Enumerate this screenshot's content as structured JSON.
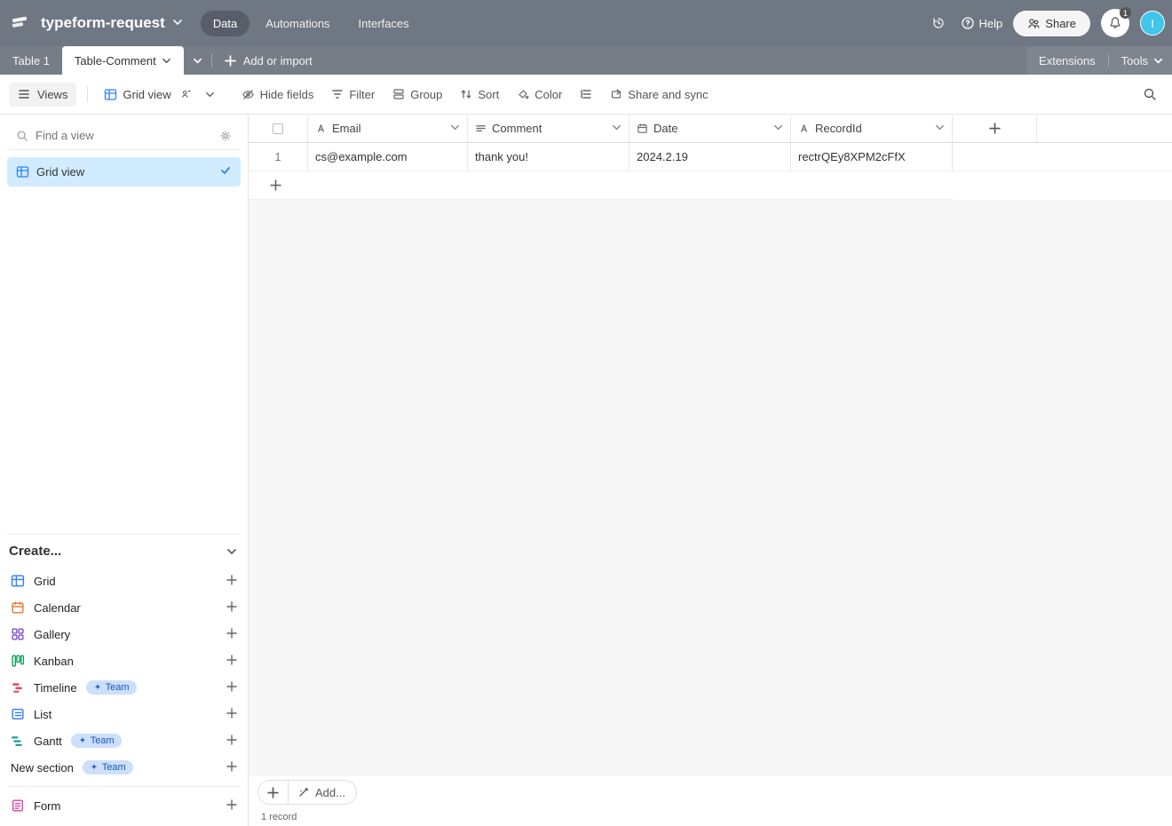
{
  "base_name": "typeform-request",
  "nav": {
    "data": "Data",
    "automations": "Automations",
    "interfaces": "Interfaces"
  },
  "topbar": {
    "help": "Help",
    "share": "Share",
    "notif_count": "1",
    "avatar_initial": "I"
  },
  "tabs": {
    "table1": "Table 1",
    "table_comment": "Table-Comment",
    "add_import": "Add or import",
    "extensions": "Extensions",
    "tools": "Tools"
  },
  "toolbar": {
    "views": "Views",
    "grid_view": "Grid view",
    "hide_fields": "Hide fields",
    "filter": "Filter",
    "group": "Group",
    "sort": "Sort",
    "color": "Color",
    "share_sync": "Share and sync"
  },
  "sidebar": {
    "find_placeholder": "Find a view",
    "views": [
      {
        "label": "Grid view"
      }
    ],
    "create_label": "Create...",
    "create_items": [
      {
        "label": "Grid",
        "icon": "grid",
        "team": false
      },
      {
        "label": "Calendar",
        "icon": "calendar",
        "team": false
      },
      {
        "label": "Gallery",
        "icon": "gallery",
        "team": false
      },
      {
        "label": "Kanban",
        "icon": "kanban",
        "team": false
      },
      {
        "label": "Timeline",
        "icon": "timeline",
        "team": true
      },
      {
        "label": "List",
        "icon": "list",
        "team": false
      },
      {
        "label": "Gantt",
        "icon": "gantt",
        "team": true
      },
      {
        "label": "New section",
        "icon": "section",
        "team": true
      }
    ],
    "team_label": "Team",
    "form_label": "Form"
  },
  "columns": {
    "email": "Email",
    "comment": "Comment",
    "date": "Date",
    "recordid": "RecordId"
  },
  "rows": [
    {
      "num": "1",
      "email": "cs@example.com",
      "comment": "thank you!",
      "date": "2024.2.19",
      "recordid": "rectrQEy8XPM2cFfX"
    }
  ],
  "footer": {
    "add_label": "Add...",
    "record_count": "1 record"
  }
}
